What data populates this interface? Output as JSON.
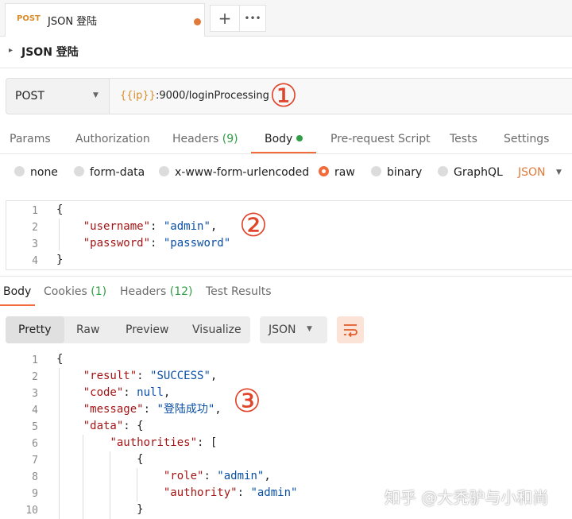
{
  "tab": {
    "method": "POST",
    "title": "JSON 登陆",
    "add_icon": "+",
    "more_icon": "•••"
  },
  "breadcrumb": {
    "chevron": "▸",
    "name": "JSON 登陆"
  },
  "request": {
    "method": "POST",
    "url_var": "{{ip}}",
    "url_rest": ":9000/loginProcessing",
    "marker": "①"
  },
  "request_tabs": [
    {
      "label": "Params"
    },
    {
      "label": "Authorization"
    },
    {
      "label": "Headers",
      "count": "(9)"
    },
    {
      "label": "Body"
    },
    {
      "label": "Pre-request Script"
    },
    {
      "label": "Tests"
    },
    {
      "label": "Settings"
    }
  ],
  "body_types": [
    "none",
    "form-data",
    "x-www-form-urlencoded",
    "raw",
    "binary",
    "GraphQL"
  ],
  "body_language": "JSON",
  "request_body": {
    "line_numbers": [
      "1",
      "2",
      "3",
      "4"
    ],
    "marker": "②",
    "open": "{",
    "close": "}",
    "key1": "\"username\"",
    "val1": "\"admin\"",
    "key2": "\"password\"",
    "val2": "\"password\""
  },
  "response_tabs": [
    {
      "label": "Body"
    },
    {
      "label": "Cookies",
      "count": "(1)"
    },
    {
      "label": "Headers",
      "count": "(12)"
    },
    {
      "label": "Test Results"
    }
  ],
  "view_modes": [
    "Pretty",
    "Raw",
    "Preview",
    "Visualize"
  ],
  "response_format": "JSON",
  "response_body": {
    "line_numbers": [
      "1",
      "2",
      "3",
      "4",
      "5",
      "6",
      "7",
      "8",
      "9",
      "10"
    ],
    "marker": "③",
    "open": "{",
    "k_result": "\"result\"",
    "v_result": "\"SUCCESS\"",
    "k_code": "\"code\"",
    "v_code": "null",
    "k_message": "\"message\"",
    "v_message": "\"登陆成功\"",
    "k_data": "\"data\"",
    "k_authorities": "\"authorities\"",
    "k_role": "\"role\"",
    "v_role": "\"admin\"",
    "k_authority": "\"authority\"",
    "v_authority": "\"admin\""
  },
  "watermark": "知乎 @大秃驴与小和尚"
}
